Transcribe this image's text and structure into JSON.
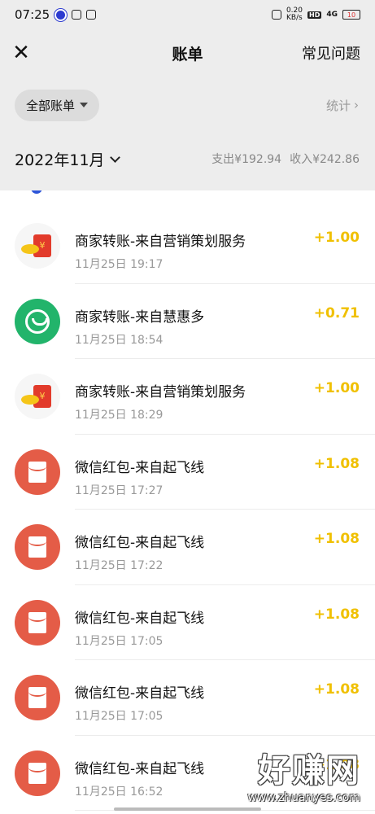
{
  "status": {
    "time": "07:25",
    "speed": "0.20\nKB/s",
    "network": "4G",
    "hd": "HD",
    "battery": "10"
  },
  "header": {
    "title": "账单",
    "faq": "常见问题"
  },
  "filter": {
    "all_bills": "全部账单",
    "stats": "统计"
  },
  "month": {
    "label": "2022年11月",
    "expense": "支出¥192.94",
    "income": "收入¥242.86"
  },
  "transactions": [
    {
      "name": "商家转账-来自营销策划服务",
      "time": "11月25日 19:17",
      "amount": "+1.00",
      "icon": "red-packet-coins-icon"
    },
    {
      "name": "商家转账-来自慧惠多",
      "time": "11月25日 18:54",
      "amount": "+0.71",
      "icon": "huihuiduo-logo-icon"
    },
    {
      "name": "商家转账-来自营销策划服务",
      "time": "11月25日 18:29",
      "amount": "+1.00",
      "icon": "red-packet-coins-icon"
    },
    {
      "name": "微信红包-来自起飞线",
      "time": "11月25日 17:27",
      "amount": "+1.08",
      "icon": "red-envelope-icon"
    },
    {
      "name": "微信红包-来自起飞线",
      "time": "11月25日 17:22",
      "amount": "+1.08",
      "icon": "red-envelope-icon"
    },
    {
      "name": "微信红包-来自起飞线",
      "time": "11月25日 17:05",
      "amount": "+1.08",
      "icon": "red-envelope-icon"
    },
    {
      "name": "微信红包-来自起飞线",
      "time": "11月25日 17:05",
      "amount": "+1.08",
      "icon": "red-envelope-icon"
    },
    {
      "name": "微信红包-来自起飞线",
      "time": "11月25日 16:52",
      "amount": "+1.08",
      "icon": "red-envelope-icon"
    }
  ],
  "watermark": {
    "big": "好赚网",
    "small": "www.zhuanyes.com"
  },
  "colors": {
    "amount": "#f0c000",
    "red_envelope": "#e45c47",
    "huihuiduo": "#22b46b"
  }
}
